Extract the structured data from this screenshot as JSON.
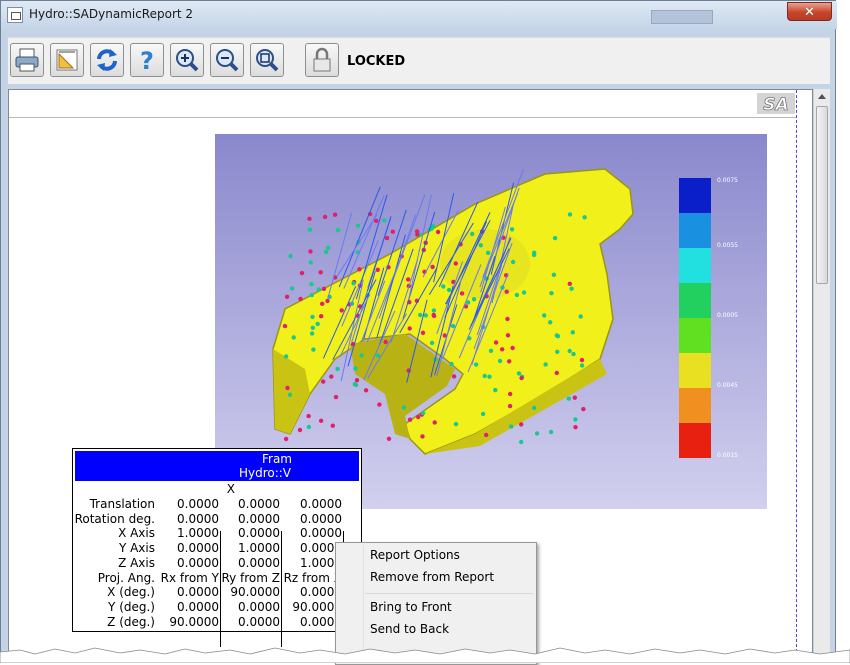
{
  "window": {
    "title": "Hydro::SADynamicReport 2",
    "close_glyph": "✕"
  },
  "toolbar": {
    "buttons": [
      {
        "name": "print-icon"
      },
      {
        "name": "page-setup-icon"
      },
      {
        "name": "refresh-icon"
      },
      {
        "name": "help-icon"
      },
      {
        "name": "zoom-in-icon"
      },
      {
        "name": "zoom-out-icon"
      },
      {
        "name": "zoom-fit-icon"
      },
      {
        "name": "lock-icon"
      }
    ],
    "status_label": "LOCKED"
  },
  "report": {
    "logo_text": "SA",
    "legend_labels": [
      "0.0075",
      "0.0055",
      "0.0005",
      "0.0045",
      "0.0015"
    ],
    "table": {
      "header_line1": "Fram",
      "header_line2": "Hydro::V",
      "col_label_x": "X",
      "rows": [
        {
          "label": "Translation",
          "c1": "0.0000",
          "c2": "0.0000",
          "c3": "0.0000"
        },
        {
          "label": "Rotation deg.",
          "c1": "0.0000",
          "c2": "0.0000",
          "c3": "0.0000"
        },
        {
          "label": "X Axis",
          "c1": "1.0000",
          "c2": "0.0000",
          "c3": "0.0000"
        },
        {
          "label": "Y Axis",
          "c1": "0.0000",
          "c2": "1.0000",
          "c3": "0.0000"
        },
        {
          "label": "Z Axis",
          "c1": "0.0000",
          "c2": "0.0000",
          "c3": "1.0000"
        },
        {
          "label": "Proj. Ang.",
          "c1": "Rx from Y",
          "c2": "Ry from Z",
          "c3": "Rz from X"
        },
        {
          "label": "X (deg.)",
          "c1": "0.0000",
          "c2": "90.0000",
          "c3": "0.0000"
        },
        {
          "label": "Y (deg.)",
          "c1": "0.0000",
          "c2": "0.0000",
          "c3": "90.0000"
        },
        {
          "label": "Z (deg.)",
          "c1": "90.0000",
          "c2": "0.0000",
          "c3": "0.0000"
        }
      ]
    }
  },
  "context_menu": {
    "items": [
      "Report Options",
      "Remove from Report",
      "Bring to Front",
      "Send to Back"
    ]
  },
  "colors": {
    "accent_blue": "#0000ff",
    "highlight_green": "#7ff070",
    "part_yellow": "#f2f01a"
  }
}
